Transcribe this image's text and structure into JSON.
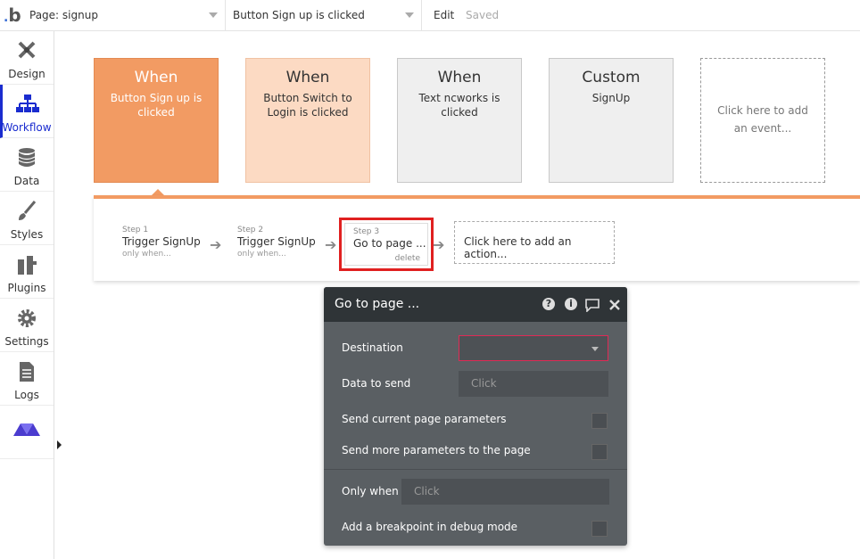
{
  "topbar": {
    "logo": "b",
    "page_select": "Page: signup",
    "event_select": "Button Sign up is clicked",
    "edit": "Edit",
    "saved": "Saved"
  },
  "sidebar": {
    "items": [
      {
        "label": "Design",
        "icon": "design-icon"
      },
      {
        "label": "Workflow",
        "icon": "workflow-icon",
        "active": true
      },
      {
        "label": "Data",
        "icon": "database-icon"
      },
      {
        "label": "Styles",
        "icon": "brush-icon"
      },
      {
        "label": "Plugins",
        "icon": "plugin-icon"
      },
      {
        "label": "Settings",
        "icon": "gear-icon"
      },
      {
        "label": "Logs",
        "icon": "document-icon"
      },
      {
        "label": "",
        "icon": "brand-logo-icon"
      }
    ]
  },
  "events": [
    {
      "title": "When",
      "subtitle": "Button Sign up is clicked"
    },
    {
      "title": "When",
      "subtitle": "Button Switch to Login is clicked"
    },
    {
      "title": "When",
      "subtitle": "Text ncworks is clicked"
    },
    {
      "title": "Custom",
      "subtitle": "SignUp"
    },
    {
      "title": "",
      "subtitle": "Click here to add an event..."
    }
  ],
  "actions": {
    "steps": [
      {
        "number": "Step 1",
        "title": "Trigger SignUp",
        "when": "only when..."
      },
      {
        "number": "Step 2",
        "title": "Trigger SignUp",
        "when": "only when..."
      },
      {
        "number": "Step 3",
        "title": "Go to page ...",
        "delete": "delete"
      }
    ],
    "add_action": "Click here to add an action..."
  },
  "panel": {
    "title": "Go to page ...",
    "destination_label": "Destination",
    "destination_value": "",
    "data_to_send_label": "Data to send",
    "data_to_send_placeholder": "Click",
    "send_current_params_label": "Send current page parameters",
    "send_more_params_label": "Send more parameters to the page",
    "only_when_label": "Only when",
    "only_when_placeholder": "Click",
    "breakpoint_label": "Add a breakpoint in debug mode"
  },
  "colors": {
    "accent_orange": "#f29b63",
    "active_blue": "#1a2ccf",
    "highlight_red": "#e02020"
  }
}
